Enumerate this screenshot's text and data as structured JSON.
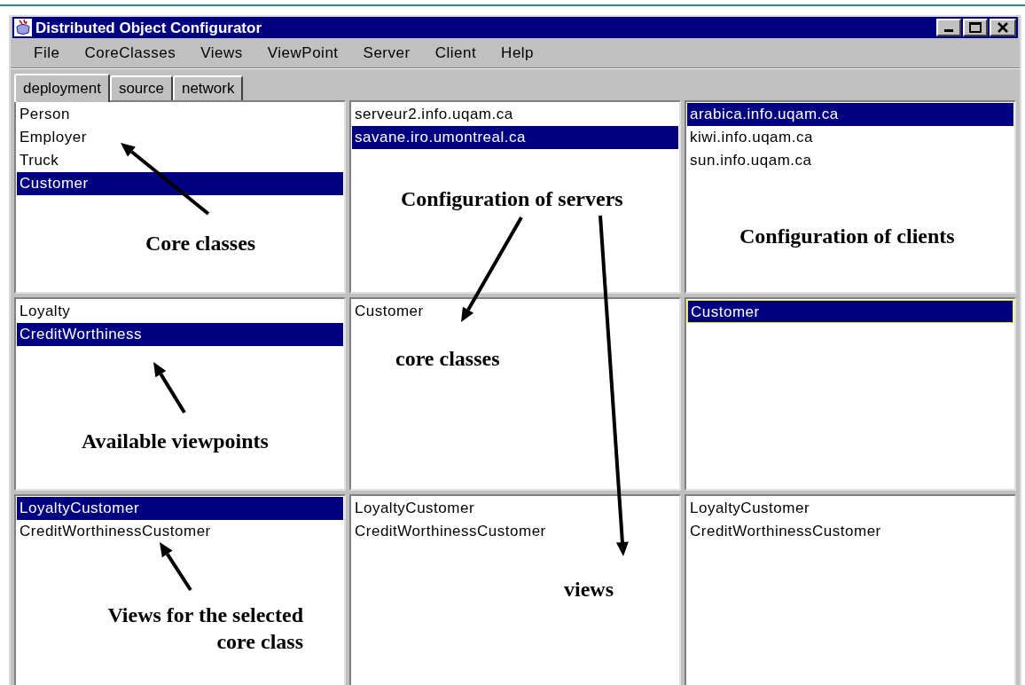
{
  "window": {
    "title": "Distributed Object Configurator"
  },
  "menu": [
    "File",
    "CoreClasses",
    "Views",
    "ViewPoint",
    "Server",
    "Client",
    "Help"
  ],
  "tabs": [
    {
      "label": "deployment",
      "selected": true
    },
    {
      "label": "source",
      "selected": false
    },
    {
      "label": "network",
      "selected": false
    }
  ],
  "panels": [
    {
      "items": [
        {
          "label": "Person",
          "selected": false
        },
        {
          "label": "Employer",
          "selected": false
        },
        {
          "label": "Truck",
          "selected": false
        },
        {
          "label": "Customer",
          "selected": true
        }
      ]
    },
    {
      "items": [
        {
          "label": "serveur2.info.uqam.ca",
          "selected": false
        },
        {
          "label": "savane.iro.umontreal.ca",
          "selected": true
        }
      ]
    },
    {
      "items": [
        {
          "label": "arabica.info.uqam.ca",
          "selected": true
        },
        {
          "label": "kiwi.info.uqam.ca",
          "selected": false
        },
        {
          "label": "sun.info.uqam.ca",
          "selected": false
        }
      ]
    },
    {
      "items": [
        {
          "label": "Loyalty",
          "selected": false
        },
        {
          "label": "CreditWorthiness",
          "selected": true
        }
      ]
    },
    {
      "items": [
        {
          "label": "Customer",
          "selected": false
        }
      ]
    },
    {
      "items": [
        {
          "label": "Customer",
          "selected": true,
          "focused": true
        }
      ]
    },
    {
      "items": [
        {
          "label": "LoyaltyCustomer",
          "selected": true
        },
        {
          "label": "CreditWorthinessCustomer",
          "selected": false
        }
      ]
    },
    {
      "items": [
        {
          "label": "LoyaltyCustomer",
          "selected": false
        },
        {
          "label": "CreditWorthinessCustomer",
          "selected": false
        }
      ]
    },
    {
      "items": [
        {
          "label": "LoyaltyCustomer",
          "selected": false
        },
        {
          "label": "CreditWorthinessCustomer",
          "selected": false
        }
      ]
    }
  ],
  "annotations": [
    "Core classes",
    "Configuration of servers",
    "Configuration of clients",
    "core classes",
    "Available viewpoints",
    "views",
    "Views for the selected core class"
  ]
}
